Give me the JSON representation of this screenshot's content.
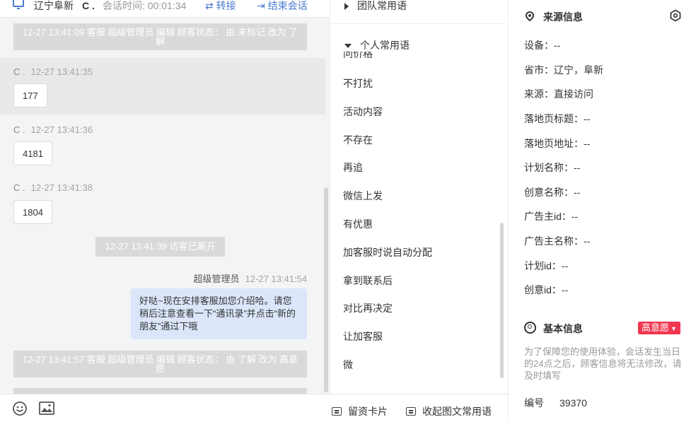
{
  "header": {
    "location": "辽宁阜新",
    "visitor": "C .",
    "session_label": "会话时间: 00:01:34",
    "transfer_label": "转接",
    "end_label": "结束会话"
  },
  "messages": {
    "sys1": "12-27 13:41:09 客服 超级管理员 编辑 顾客状态： 由 未标记 改为 了解",
    "m1_who": "C .",
    "m1_time": "12-27 13:41:35",
    "m1_text": "177",
    "m2_who": "C .",
    "m2_time": "12-27 13:41:36",
    "m2_text": "4181",
    "m3_who": "C .",
    "m3_time": "12-27 13:41:38",
    "m3_text": "1804",
    "left": "12-27 13:41:39 访客已离开",
    "agent_name": "超级管理员",
    "agent_time": "12-27 13:41:54",
    "agent_text": "好哒~现在安排客服加您介绍哈。请您稍后注意查看一下“通讯录”并点击“新的朋友”通过下哦",
    "sys2": "12-27 13:41:57 客服 超级管理员 编辑 顾客状态： 由 了解 改为 高意愿"
  },
  "phrases": {
    "team_group": "团队常用语",
    "personal_group": "个人常用语",
    "cut_item": "问价格",
    "items": [
      "不打扰",
      "活动内容",
      "不存在",
      "再追",
      "微信上发",
      "有优惠",
      "加客服时说自动分配",
      "拿到联系后",
      "对比再决定",
      "让加客服",
      "微"
    ]
  },
  "footer": {
    "card_label": "留资卡片",
    "collapse_label": "收起图文常用语"
  },
  "source": {
    "title": "来源信息",
    "device": "设备：--",
    "province": "省市：辽宁，阜新",
    "from": "来源：直接访问",
    "landing_title": "落地页标题：--",
    "landing_url": "落地页地址：--",
    "plan_name": "计划名称：--",
    "creative_name": "创意名称：--",
    "advertiser_id": "广告主id：--",
    "advertiser_name": "广告主名称：--",
    "plan_id": "计划id：--",
    "creative_id": "创意id：--"
  },
  "basic": {
    "title": "基本信息",
    "intent_badge": "高意愿",
    "note": "为了保障您的使用体验，会话发生当日的24点之后，顾客信息将无法修改，请及时填写",
    "id_label": "编号",
    "id_value": "39370"
  },
  "colors": {
    "accent": "#4a7bd0",
    "badge": "#f0374f",
    "agent_bubble": "#dbe6fa"
  }
}
